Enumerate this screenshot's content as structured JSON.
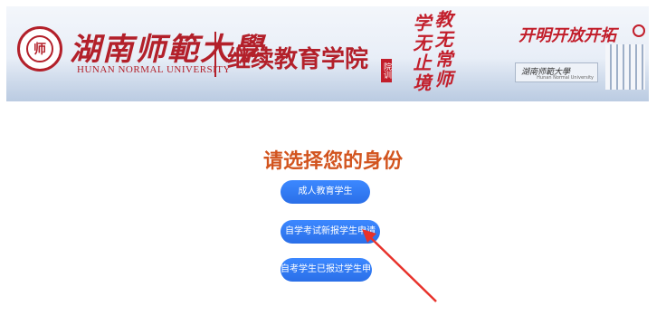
{
  "header": {
    "university_name_cn": "湖南师範大學",
    "university_name_en": "HUNAN NORMAL UNIVERSITY",
    "seal_text": "师",
    "college_name": "继续教育学院",
    "motto_col1": "学无止境",
    "motto_col2": "教无常师",
    "motto_stamp": "院训",
    "slogan": "开明开放开拓",
    "gate_sign": "湖南师範大學",
    "gate_sign_sub": "Hunan Normal University"
  },
  "main": {
    "heading": "请选择您的身份",
    "buttons": [
      {
        "label": "成人教育学生"
      },
      {
        "label": "自学考试新报学生申请"
      },
      {
        "label": "自考学生已报过学生申请"
      }
    ]
  },
  "colors": {
    "brand_red": "#b3202a",
    "heading_orange": "#d2541e",
    "button_blue": "#2f7bf5",
    "annotation_arrow": "#e8322b"
  },
  "icons": [
    "university-seal-icon",
    "annotation-arrow"
  ]
}
